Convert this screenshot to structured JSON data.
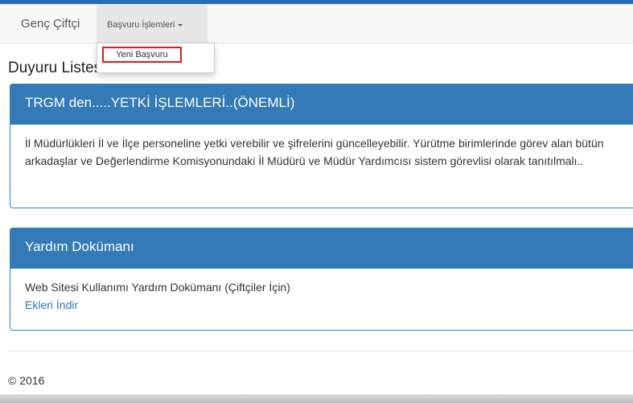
{
  "navbar": {
    "brand": "Genç Çiftçi",
    "dropdown_label": "Başvuru İşlemleri",
    "dropdown_items": [
      "Yeni Başvuru"
    ]
  },
  "page": {
    "title": "Duyuru Listesi"
  },
  "panels": [
    {
      "heading": "TRGM den.....YETKİ İŞLEMLERİ..(ÖNEMLİ)",
      "body": "İl Müdürlükleri İl ve İlçe personeline yetki verebilir ve şifrelerini güncelleyebilir. Yürütme birimlerinde görev alan bütün arkadaşlar ve Değerlendirme Komisyonundaki İl Müdürü ve Müdür Yardımcısı sistem görevlisi olarak tanıtılmalı.."
    },
    {
      "heading": "Yardım Dokümanı",
      "body": "Web Sitesi Kullanımı Yardım Dokümanı (Çiftçiler İçin)",
      "link": "Ekleri İndir"
    }
  ],
  "footer": {
    "text": "© 2016"
  },
  "colors": {
    "primary": "#337ab7",
    "highlight_border": "#e0181f",
    "link": "#2a7ab9"
  }
}
